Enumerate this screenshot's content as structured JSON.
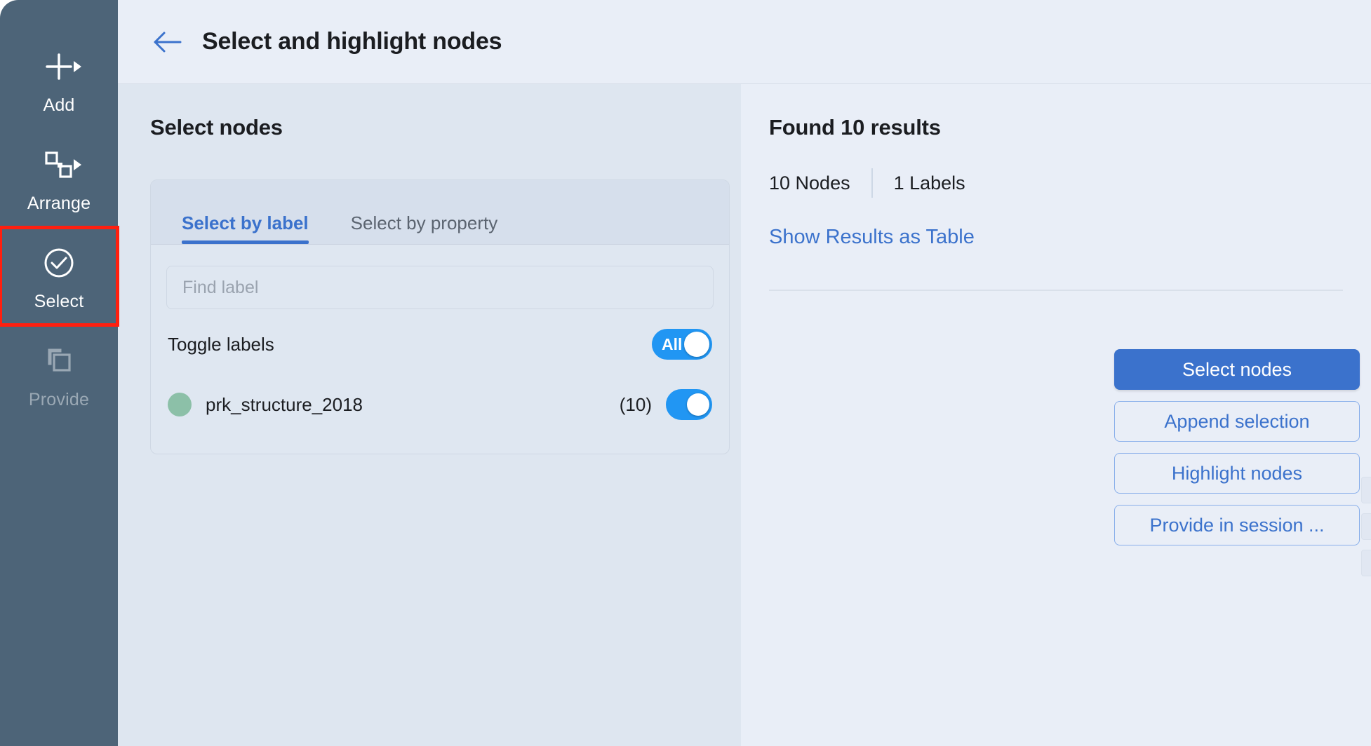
{
  "sidebar": {
    "items": [
      {
        "label": "Add",
        "icon": "plus-icon",
        "has_caret": true,
        "state": "enabled"
      },
      {
        "label": "Arrange",
        "icon": "arrange-squares-icon",
        "has_caret": true,
        "state": "enabled"
      },
      {
        "label": "Select",
        "icon": "check-circle-icon",
        "has_caret": false,
        "state": "active"
      },
      {
        "label": "Provide",
        "icon": "copy-layers-icon",
        "has_caret": false,
        "state": "disabled"
      }
    ]
  },
  "header": {
    "back_icon": "arrow-left-icon",
    "title": "Select and highlight nodes"
  },
  "left_pane": {
    "heading": "Select nodes",
    "tabs": [
      {
        "label": "Select by label",
        "selected": true
      },
      {
        "label": "Select by property",
        "selected": false
      }
    ],
    "find_label": {
      "placeholder": "Find label",
      "value": ""
    },
    "toggle_labels": {
      "label": "Toggle labels",
      "switch_text": "All",
      "switch_on": true
    },
    "labels": [
      {
        "name": "prk_structure_2018",
        "count": "(10)",
        "dot_color": "#8cc0a8",
        "switch_on": true
      }
    ]
  },
  "right_pane": {
    "heading": "Found 10 results",
    "counts": [
      {
        "text": "10 Nodes"
      },
      {
        "text": "1 Labels"
      }
    ],
    "show_results_link": "Show Results as Table",
    "buttons": [
      {
        "label": "Select nodes",
        "style": "primary"
      },
      {
        "label": "Append selection",
        "style": "secondary"
      },
      {
        "label": "Highlight nodes",
        "style": "secondary"
      },
      {
        "label": "Provide in session ...",
        "style": "secondary"
      }
    ]
  },
  "colors": {
    "rail_bg": "#4d6478",
    "accent_blue": "#3b72cc",
    "switch_blue": "#2196f3",
    "left_pane_bg": "#dee6f0",
    "right_pane_bg": "#e9eef7",
    "highlight_outline": "#ff1f0f"
  }
}
